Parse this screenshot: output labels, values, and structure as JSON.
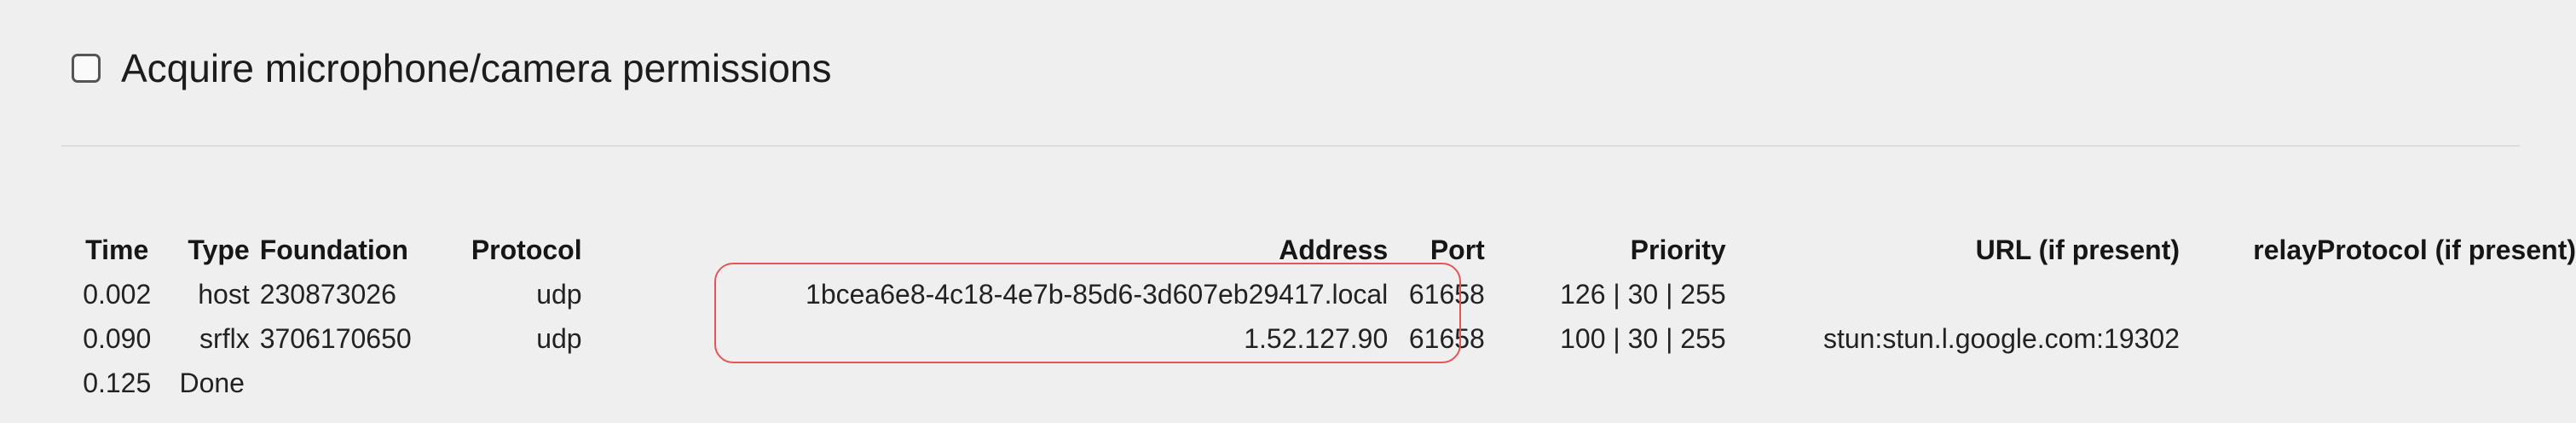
{
  "permissions": {
    "label": "Acquire microphone/camera permissions",
    "checked": false
  },
  "table": {
    "headers": {
      "time": "Time",
      "type": "Type",
      "foundation": "Foundation",
      "protocol": "Protocol",
      "address": "Address",
      "port": "Port",
      "priority": "Priority",
      "url": "URL (if present)",
      "relay_protocol": "relayProtocol (if present)"
    },
    "rows": [
      {
        "time": "0.002",
        "type": "host",
        "foundation": "230873026",
        "protocol": "udp",
        "address": "1bcea6e8-4c18-4e7b-85d6-3d607eb29417.local",
        "port": "61658",
        "priority": "126 | 30 | 255",
        "url": "",
        "relay_protocol": ""
      },
      {
        "time": "0.090",
        "type": "srflx",
        "foundation": "3706170650",
        "protocol": "udp",
        "address": "1.52.127.90",
        "port": "61658",
        "priority": "100 | 30 | 255",
        "url": "stun:stun.l.google.com:19302",
        "relay_protocol": ""
      }
    ],
    "done": {
      "time": "0.125",
      "label": "Done"
    }
  },
  "colors": {
    "background": "#efefef",
    "highlight": "#e35656"
  }
}
